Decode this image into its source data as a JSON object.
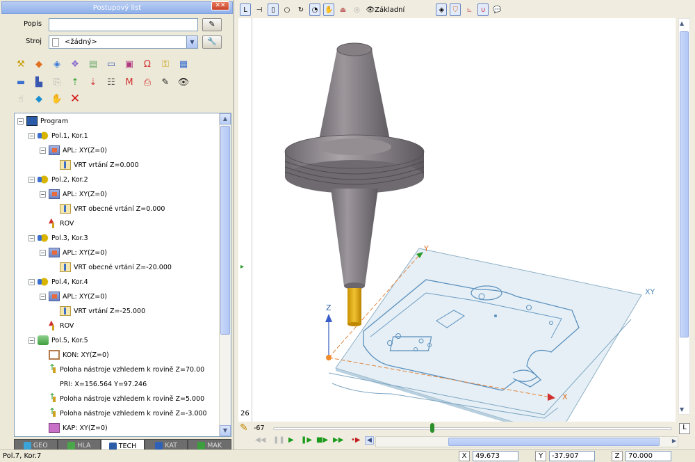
{
  "panel": {
    "title": "Postupový list",
    "popis_label": "Popis",
    "popis_value": "",
    "stroj_label": "Stroj",
    "stroj_value": "<žádný>"
  },
  "tree": {
    "root": "Program",
    "items": [
      {
        "type": "pol",
        "label": "Pol.1, Kor.1"
      },
      {
        "type": "apl",
        "label": "APL: XY(Z=0)"
      },
      {
        "type": "vrt",
        "label": "VRT vrtání Z=0.000"
      },
      {
        "type": "pol",
        "label": "Pol.2, Kor.2"
      },
      {
        "type": "apl",
        "label": "APL: XY(Z=0)"
      },
      {
        "type": "vrt",
        "label": "VRT obecné vrtání Z=0.000"
      },
      {
        "type": "rov",
        "label": "ROV"
      },
      {
        "type": "pol",
        "label": "Pol.3, Kor.3"
      },
      {
        "type": "apl",
        "label": "APL: XY(Z=0)"
      },
      {
        "type": "vrt",
        "label": "VRT obecné vrtání Z=-20.000"
      },
      {
        "type": "pol",
        "label": "Pol.4, Kor.4"
      },
      {
        "type": "apl",
        "label": "APL: XY(Z=0)"
      },
      {
        "type": "vrt",
        "label": "VRT vrtání Z=-25.000"
      },
      {
        "type": "rov",
        "label": "ROV"
      },
      {
        "type": "pol5",
        "label": "Pol.5, Kor.5"
      },
      {
        "type": "kon",
        "label": "KON: XY(Z=0)"
      },
      {
        "type": "polohar",
        "label": "Poloha nástroje vzhledem k rovině Z=70.00"
      },
      {
        "type": "pri",
        "label": "PRI: X=156.564  Y=97.246"
      },
      {
        "type": "polohar",
        "label": "Poloha nástroje vzhledem k rovině Z=5.000"
      },
      {
        "type": "polohar",
        "label": "Poloha nástroje vzhledem k rovině Z=-3.000"
      },
      {
        "type": "kap",
        "label": "KAP: XY(Z=0)"
      }
    ]
  },
  "tabs": [
    {
      "label": "GEO",
      "color": "#3aa3d8",
      "active": false
    },
    {
      "label": "HLA",
      "color": "#4aa84a",
      "active": false
    },
    {
      "label": "TECH",
      "color": "#2a5ca8",
      "active": true
    },
    {
      "label": "KAT",
      "color": "#3061b8",
      "active": false
    },
    {
      "label": "MAK",
      "color": "#3c9e3c",
      "active": false
    }
  ],
  "viewport": {
    "toolbar_label": "Základní",
    "axis_y": "Y",
    "axis_z": "Z",
    "axis_x": "X",
    "plane_label": "XY",
    "slider_min": "-67",
    "left_value": "26"
  },
  "status": {
    "position": "Pol.7, Kor.7",
    "x_label": "X",
    "x_value": "49.673",
    "y_label": "Y",
    "y_value": "-37.907",
    "z_label": "Z",
    "z_value": "70.000"
  }
}
